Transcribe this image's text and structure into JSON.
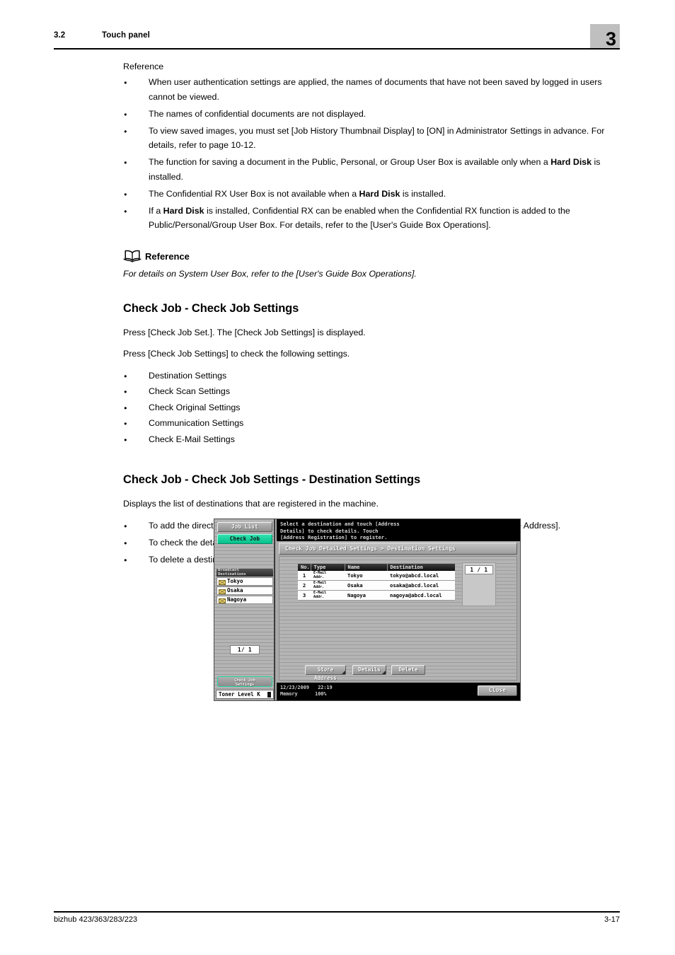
{
  "header": {
    "section_number": "3.2",
    "section_title": "Touch panel",
    "chapter_number": "3"
  },
  "body": {
    "reference_label": "Reference",
    "reference_bullets": [
      "When user authentication settings are applied, the names of documents that have not been saved by logged in users cannot be viewed.",
      "The names of confidential documents are not displayed.",
      "To view saved images, you must set [Job History Thumbnail Display] to [ON] in Administrator Settings in advance. For details, refer to page 10-12."
    ],
    "bullet_hd_1_a": "The function for saving a document in the Public, Personal, or Group User Box is available only when a ",
    "bullet_hd_1_b": "Hard Disk",
    "bullet_hd_1_c": " is installed.",
    "bullet_hd_2_a": "The Confidential RX User Box is not available when a ",
    "bullet_hd_2_b": "Hard Disk",
    "bullet_hd_2_c": " is installed.",
    "bullet_hd_3_a": "If a ",
    "bullet_hd_3_b": "Hard Disk",
    "bullet_hd_3_c": " is installed, Confidential RX can be enabled when the Confidential RX function is added to the Public/Personal/Group User Box. For details, refer to the [User's Guide Box Operations].",
    "ref_block_title": "Reference",
    "ref_block_text": "For details on System User Box, refer to the [User's Guide Box Operations].",
    "heading_1": "Check Job - Check Job Settings",
    "para_1": "Press [Check Job Set.]. The [Check Job Settings] is displayed.",
    "para_2": "Press [Check Job Settings] to check the following settings.",
    "settings_list": [
      "Destination Settings",
      "Check Scan Settings",
      "Check Original Settings",
      "Communication Settings",
      "Check E-Mail Settings"
    ],
    "heading_2": "Check Job - Check Job Settings - Destination Settings",
    "para_3": "Displays the list of destinations that are registered in the machine.",
    "dest_bullets": [
      "To add the directly entered address to the address book, select the destination, and press [Store Address].",
      "To check the detailed information of the destination, select a destination, and press [Details].",
      "To delete a destination, select one you want to delete, and then press [Delete]."
    ]
  },
  "panel": {
    "job_list_button": "Job List",
    "check_job_button": "Check Job",
    "broadcast_header_line1": "Broadcast",
    "broadcast_header_line2": "Destinations",
    "broadcast_items": [
      "Tokyo",
      "Osaka",
      "Nagoya"
    ],
    "left_page_indicator": "1/  1",
    "check_job_settings_line1": "Check Job",
    "check_job_settings_line2": "Settings",
    "toner_label": "Toner Level",
    "toner_k": "K",
    "message_line1": "Select a destination and touch [Address",
    "message_line2": "Details] to check details. Touch",
    "message_line3": "[Address Registration] to register.",
    "breadcrumb": "Check Job Detailed Settings > Destination Settings",
    "table": {
      "columns": [
        "No.",
        "Type",
        "Name",
        "Destination"
      ],
      "rows": [
        {
          "no": "1",
          "type_line1": "E-Mail",
          "type_line2": "Addr.",
          "name": "Tokyo",
          "destination": "tokyo@abcd.local"
        },
        {
          "no": "2",
          "type_line1": "E-Mail",
          "type_line2": "Addr.",
          "name": "Osaka",
          "destination": "osaka@abcd.local"
        },
        {
          "no": "3",
          "type_line1": "E-Mail",
          "type_line2": "Addr.",
          "name": "Nagoya",
          "destination": "nagoya@abcd.local"
        }
      ]
    },
    "right_page_indicator": "1 / 1",
    "store_address_button": "Store Address",
    "details_button": "Details",
    "delete_button": "Delete",
    "status_date": "12/23/2009",
    "status_time": "22:19",
    "status_memory_label": "Memory",
    "status_memory_value": "100%",
    "close_button": "Close"
  },
  "footer": {
    "product": "bizhub 423/363/283/223",
    "page_number": "3-17"
  }
}
